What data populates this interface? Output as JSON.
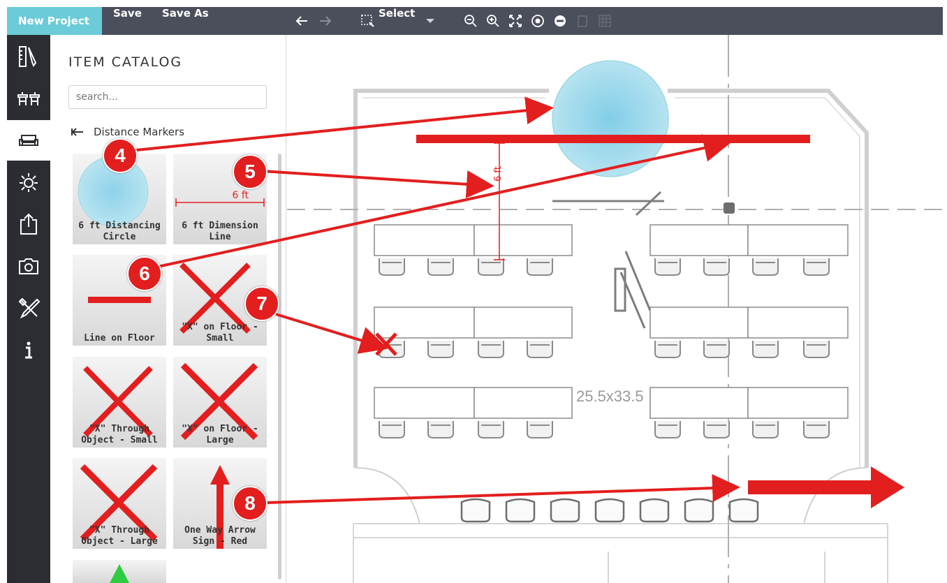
{
  "toolbar": {
    "new_project": "New Project",
    "save": "Save",
    "save_as": "Save As",
    "select_label": "Select",
    "accent": "#6bcbd8",
    "background": "#4b4f5c"
  },
  "sidebar": {
    "items": [
      {
        "icon": "ruler-pencil-icon"
      },
      {
        "icon": "furniture-icon"
      },
      {
        "icon": "sofa-icon"
      },
      {
        "icon": "light-icon"
      },
      {
        "icon": "export-icon"
      },
      {
        "icon": "camera-icon"
      },
      {
        "icon": "tools-icon"
      },
      {
        "icon": "info-icon"
      }
    ]
  },
  "catalog": {
    "title": "ITEM CATALOG",
    "search_placeholder": "search...",
    "category": "Distance Markers",
    "items": [
      {
        "line1": "6 ft Distancing",
        "line2": "Circle"
      },
      {
        "line1": "6 ft Dimension",
        "line2": "Line",
        "thumb_text": "6 ft"
      },
      {
        "line1": "Line on Floor",
        "line2": ""
      },
      {
        "line1": "\"X\" on Floor -",
        "line2": "Small"
      },
      {
        "line1": "\"X\" Through",
        "line2": "Object - Small"
      },
      {
        "line1": "\"X\" on Floor -",
        "line2": "Large"
      },
      {
        "line1": "\"X\" Through",
        "line2": "Object - Large"
      },
      {
        "line1": "One Way Arrow",
        "line2": "Sign - Red"
      }
    ]
  },
  "canvas": {
    "room_label": "25.5x33.5",
    "dimension_label": "6 ft",
    "marker_color": "#e31e1e"
  },
  "callouts": [
    "4",
    "5",
    "6",
    "7",
    "8"
  ]
}
